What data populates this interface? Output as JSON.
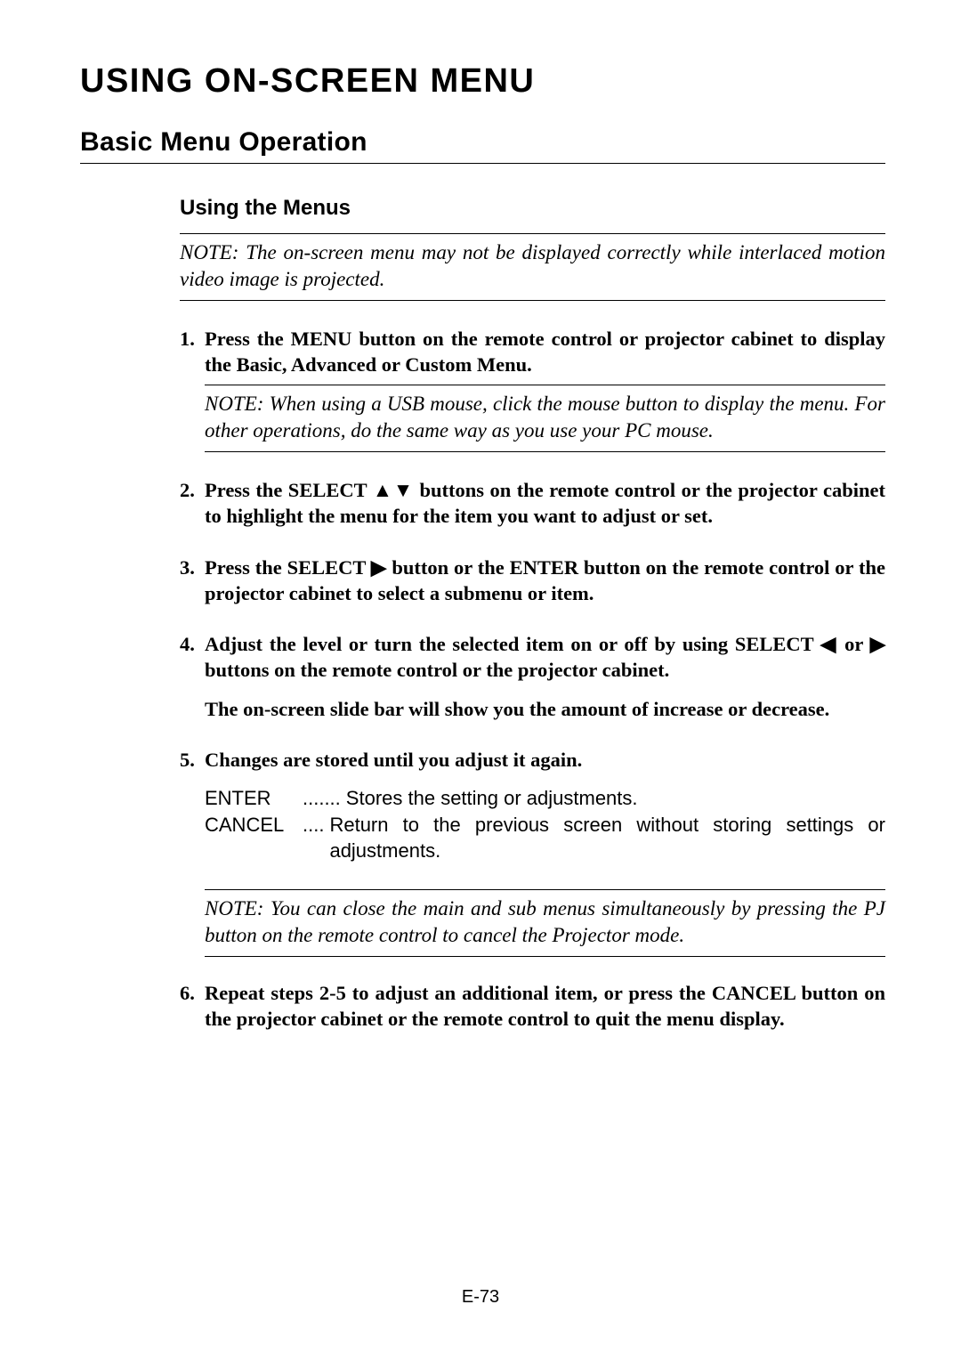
{
  "chapterTitle": "USING ON-SCREEN MENU",
  "sectionTitle": "Basic Menu Operation",
  "subTitle": "Using the Menus",
  "note1": "NOTE: The on-screen menu may not be displayed correctly while interlaced motion video image is projected.",
  "step1Num": "1.",
  "step1": "Press the MENU button on the remote control or projector cabinet to display the Basic, Advanced or Custom Menu.",
  "note2": "NOTE: When using a USB mouse, click the mouse button to display the menu. For other operations, do the same way as you use your PC mouse.",
  "step2Num": "2.",
  "step2a": "Press the SELECT ",
  "step2tri": "▲▼",
  "step2b": " buttons on the remote control or the projector cabinet to highlight the menu for the item you want to adjust or set.",
  "step3Num": "3.",
  "step3a": "Press the SELECT ",
  "step3tri": "▶",
  "step3b": " button or the ENTER button on the remote control or the projector cabinet to select a submenu or item.",
  "step4Num": "4.",
  "step4a": "Adjust the level or turn the selected item on or off by using SELECT ",
  "step4tri1": "◀",
  "step4mid": " or ",
  "step4tri2": "▶",
  "step4b": " buttons on the remote control or the projector cabinet.",
  "step4extra": "The on-screen slide bar will show you the amount of increase or decrease.",
  "step5Num": "5.",
  "step5": "Changes are stored until you adjust it again.",
  "defEnterLabel": "ENTER",
  "defEnterDots": ".......",
  "defEnterText": "Stores the setting or adjustments.",
  "defCancelLabel": "CANCEL",
  "defCancelDots": "....",
  "defCancelText": "Return to the previous screen without storing settings or adjustments.",
  "note3": "NOTE: You can close the main and sub menus simultaneously by pressing the PJ button on the remote control to cancel the Projector mode.",
  "step6Num": "6.",
  "step6": "Repeat steps 2-5 to adjust an additional item, or press the CANCEL button on the projector cabinet or the remote control to quit the menu display.",
  "pageNum": "E-73"
}
